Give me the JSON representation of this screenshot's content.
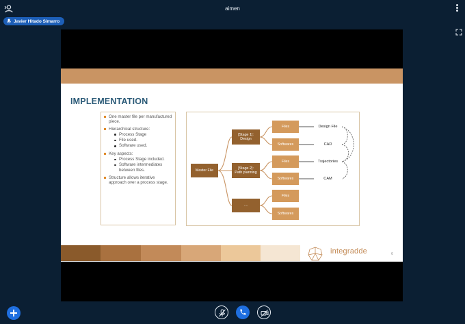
{
  "header": {
    "title": "aimen"
  },
  "presenter": {
    "name": "Javier Hitado Simarro"
  },
  "slide": {
    "heading": "IMPLEMENTATION",
    "page_number": "6",
    "logo_text": "integradde",
    "bullets": {
      "b1": "One master file per manufactured piece.",
      "b2": "Hierarchical structure:",
      "b2_s1": "Process Stage",
      "b2_s2": "File used.",
      "b2_s3": "Software used.",
      "b3": "Key aspects:",
      "b3_s1": "Process Stage included.",
      "b3_s2": "Software intermediates between files.",
      "b4": "Structure allows iterative approach over a process stage."
    },
    "diagram": {
      "master": "Master File",
      "stage1": "[Stage 1]:\nDesign",
      "stage2": "[Stage 2]:\nPath planning",
      "stage3": "....",
      "files": "Files",
      "softwares": "Softwares",
      "design_file": "Design File",
      "cad": "CAD",
      "trajectories": "Trajectories",
      "cam": "CAM"
    },
    "colors": {
      "band": "#c99463",
      "dark_node": "#93612e",
      "light_node": "#d49a5c",
      "heading": "#2c5b78",
      "swatches": [
        "#8a5a2b",
        "#a9713f",
        "#c28a59",
        "#d8a778",
        "#ecc89a",
        "#f5e6d3"
      ]
    }
  },
  "controls": {
    "add": "plus-icon",
    "mic": "mic-muted-icon",
    "phone": "phone-icon",
    "camera": "camera-off-icon"
  }
}
